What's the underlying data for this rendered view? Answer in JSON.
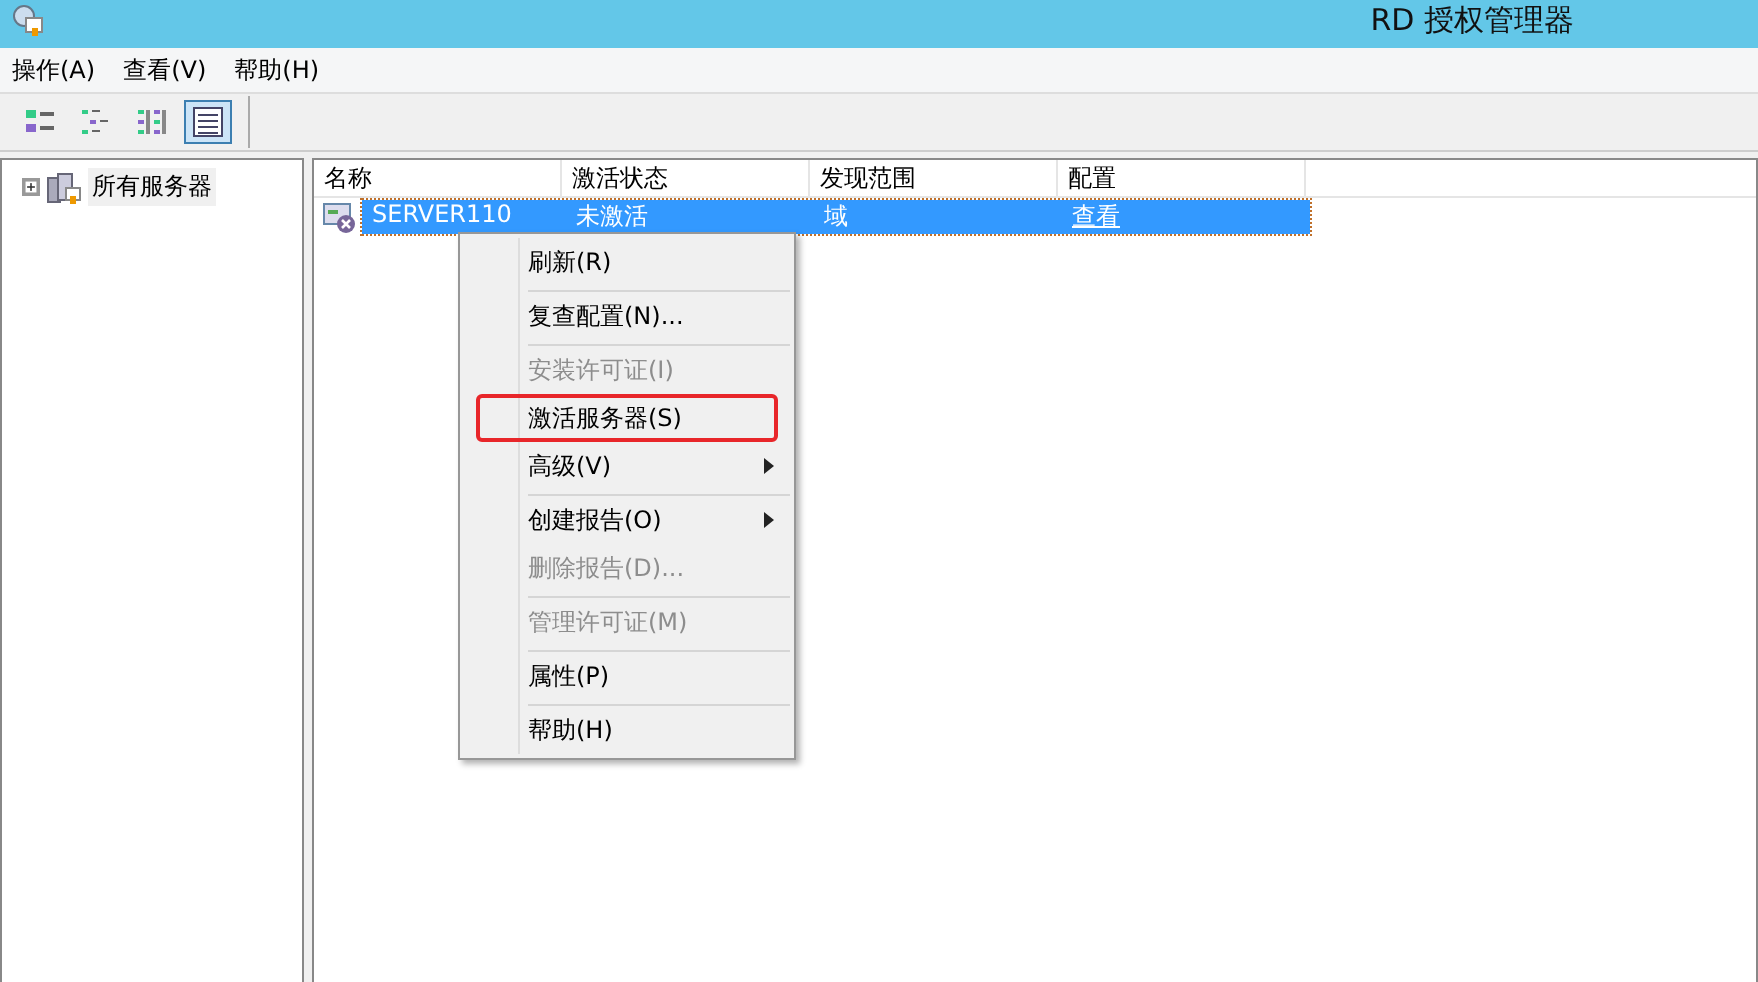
{
  "window": {
    "title": "RD 授权管理器"
  },
  "menu_bar": [
    "操作(A)",
    "查看(V)",
    "帮助(H)"
  ],
  "toolbar": [
    {
      "kind": "large",
      "selected": false
    },
    {
      "kind": "small",
      "selected": false
    },
    {
      "kind": "list",
      "selected": false
    },
    {
      "kind": "details",
      "selected": true
    }
  ],
  "tree": [
    {
      "label": "所有服务器",
      "expanded": false
    }
  ],
  "table": {
    "columns": [
      "名称",
      "激活状态",
      "发现范围",
      "配置"
    ],
    "rows": [
      {
        "name": "SERVER110",
        "status": "未激活",
        "scope": "域",
        "config": "查看",
        "selected": true
      }
    ]
  },
  "context_menu": [
    {
      "label": "刷新(R)",
      "disabled": false,
      "submenu": false,
      "highlighted": false,
      "separator_after": true
    },
    {
      "label": "复查配置(N)...",
      "disabled": false,
      "submenu": false,
      "highlighted": false,
      "separator_after": true
    },
    {
      "label": "安装许可证(I)",
      "disabled": true,
      "submenu": false,
      "highlighted": false,
      "separator_after": false
    },
    {
      "label": "激活服务器(S)",
      "disabled": false,
      "submenu": false,
      "highlighted": true,
      "separator_after": false
    },
    {
      "label": "高级(V)",
      "disabled": false,
      "submenu": true,
      "highlighted": false,
      "separator_after": true
    },
    {
      "label": "创建报告(O)",
      "disabled": false,
      "submenu": true,
      "highlighted": false,
      "separator_after": false
    },
    {
      "label": "删除报告(D)...",
      "disabled": true,
      "submenu": false,
      "highlighted": false,
      "separator_after": true
    },
    {
      "label": "管理许可证(M)",
      "disabled": true,
      "submenu": false,
      "highlighted": false,
      "separator_after": true
    },
    {
      "label": "属性(P)",
      "disabled": false,
      "submenu": false,
      "highlighted": false,
      "separator_after": true
    },
    {
      "label": "帮助(H)",
      "disabled": false,
      "submenu": false,
      "highlighted": false,
      "separator_after": false
    }
  ]
}
